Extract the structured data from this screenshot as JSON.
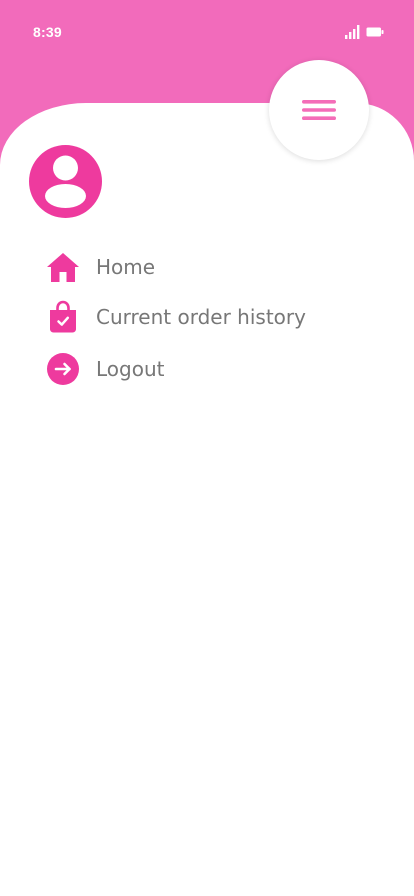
{
  "status_bar": {
    "time": "8:39",
    "icons": [
      "signal-icon",
      "battery-icon"
    ]
  },
  "menu_toggle": {
    "icon": "hamburger-icon"
  },
  "profile": {
    "avatar_icon": "user-avatar-icon"
  },
  "nav": {
    "items": [
      {
        "icon": "home-icon",
        "label": "Home"
      },
      {
        "icon": "shopping-bag-icon",
        "label": "Current order history"
      },
      {
        "icon": "logout-icon",
        "label": "Logout"
      }
    ]
  },
  "colors": {
    "header": "#f26bbb",
    "accent": "#ee3a9e",
    "hamburger": "#f46db8",
    "label": "#777777",
    "background": "#ffffff"
  }
}
